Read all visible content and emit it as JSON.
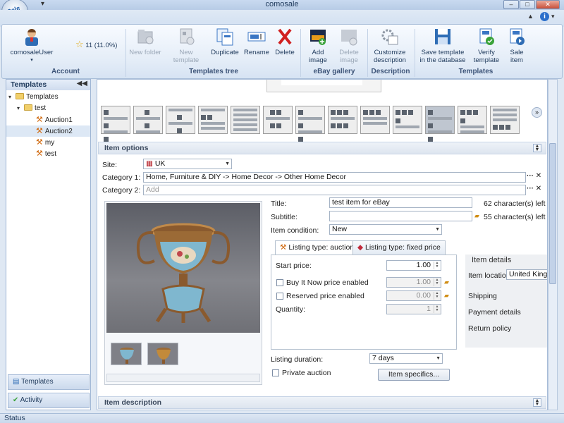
{
  "window": {
    "title": "comosale",
    "app_logo": "Sale",
    "min": "–",
    "max": "□",
    "close": "✕",
    "qat": "▾"
  },
  "help": {
    "collapse": "▲",
    "icon": "i",
    "dropdown": "▾"
  },
  "ribbon": {
    "account": {
      "user": "comosaleUser",
      "rating": "11 (11.0%)",
      "group": "Account"
    },
    "templates_tree": {
      "new_folder": "New folder",
      "new_template": "New template",
      "duplicate": "Duplicate",
      "rename": "Rename",
      "delete": "Delete",
      "group": "Templates tree"
    },
    "ebay_gallery": {
      "add_image": "Add image",
      "delete_image": "Delete image",
      "group": "eBay gallery"
    },
    "description": {
      "customize": "Customize description",
      "group": "Description"
    },
    "templates": {
      "save": "Save template in the database",
      "verify": "Verify template",
      "sale": "Sale item",
      "group": "Templates"
    }
  },
  "left_panel": {
    "header": "Templates",
    "pin": "◀◀",
    "tree": [
      {
        "label": "Templates",
        "type": "folder",
        "level": 0
      },
      {
        "label": "test",
        "type": "folder",
        "level": 1
      },
      {
        "label": "Auction1",
        "type": "item",
        "level": 2
      },
      {
        "label": "Auction2",
        "type": "item",
        "level": 2,
        "selected": true
      },
      {
        "label": "my",
        "type": "item",
        "level": 2
      },
      {
        "label": "test",
        "type": "item",
        "level": 2
      }
    ],
    "bottom_templates": "Templates",
    "bottom_activity": "Activity"
  },
  "main": {
    "template_more": "»",
    "item_options": {
      "header": "Item options",
      "site_label": "Site:",
      "site_value": "UK",
      "category1_label": "Category 1:",
      "category1_value": "Home, Furniture & DIY -> Home Decor -> Other Home Decor",
      "category2_label": "Category 2:",
      "category2_placeholder": "Add",
      "dots": "···",
      "x": "✕",
      "title_label": "Title:",
      "title_value": "test item for eBay",
      "title_remaining": "62 character(s) left",
      "subtitle_label": "Subtitle:",
      "subtitle_value": "",
      "subtitle_remaining": "55 character(s) left",
      "condition_label": "Item condition:",
      "condition_value": "New",
      "tab_auction": "Listing type: auction",
      "tab_fixed": "Listing type: fixed price",
      "start_price_label": "Start price:",
      "start_price_value": "1.00",
      "buy_now_label": "Buy It Now price enabled",
      "buy_now_value": "1.00",
      "reserved_label": "Reserved price enabled",
      "reserved_value": "0.00",
      "quantity_label": "Quantity:",
      "quantity_value": "1",
      "duration_label": "Listing duration:",
      "duration_value": "7 days",
      "private_label": "Private auction",
      "specifics_button": "Item specifics...",
      "details_header": "Item details",
      "location_label": "Item location",
      "location_value": "United Kingdom",
      "shipping": "Shipping",
      "payment": "Payment details",
      "return": "Return policy"
    },
    "item_description": {
      "header": "Item description"
    }
  },
  "status": {
    "text": "Status"
  },
  "colors": {
    "accent": "#2c6fcb",
    "ribbon_bg": "#e3ecf7",
    "selection": "#dde8f5"
  }
}
